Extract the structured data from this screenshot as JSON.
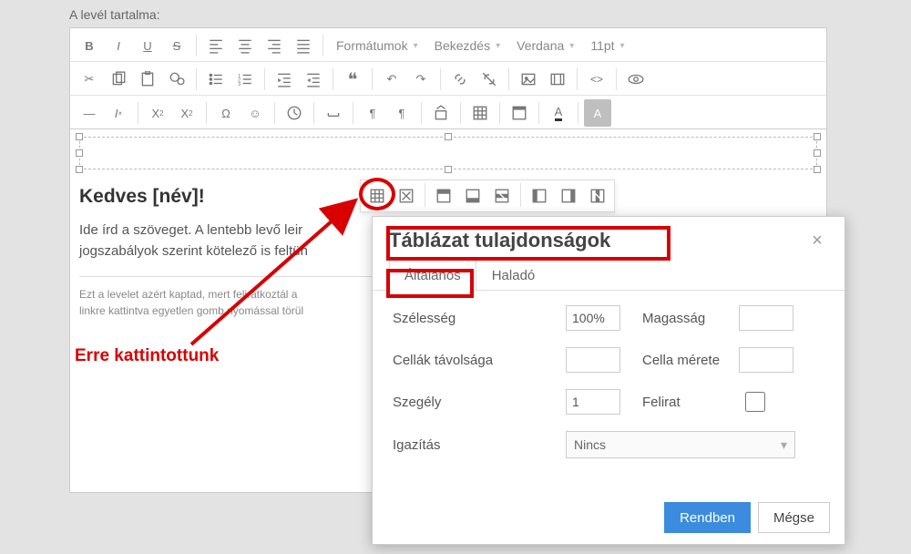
{
  "page_label": "A levél tartalma:",
  "toolbar_menus": {
    "formats": "Formátumok",
    "paragraph": "Bekezdés",
    "font": "Verdana",
    "size": "11pt"
  },
  "content": {
    "heading": "Kedves [név]!",
    "para1": "Ide írd a szöveget. A lentebb levő leir",
    "para2": "jogszabályok szerint kötelező is feltün",
    "footer1": "Ezt a levelet azért kaptad, mert feliratkoztál a",
    "footer2": "linkre kattintva egyetlen gomb nyomással törül"
  },
  "annotation_text": "Erre kattintottunk",
  "dialog": {
    "title": "Táblázat tulajdonságok",
    "tab_general": "Általános",
    "tab_advanced": "Haladó",
    "lbl_width": "Szélesség",
    "val_width": "100%",
    "lbl_height": "Magasság",
    "val_height": "",
    "lbl_cellspacing": "Cellák távolsága",
    "val_cellspacing": "",
    "lbl_cellpadding": "Cella mérete",
    "val_cellpadding": "",
    "lbl_border": "Szegély",
    "val_border": "1",
    "lbl_caption": "Felirat",
    "lbl_align": "Igazítás",
    "val_align": "Nincs",
    "btn_ok": "Rendben",
    "btn_cancel": "Mégse"
  }
}
